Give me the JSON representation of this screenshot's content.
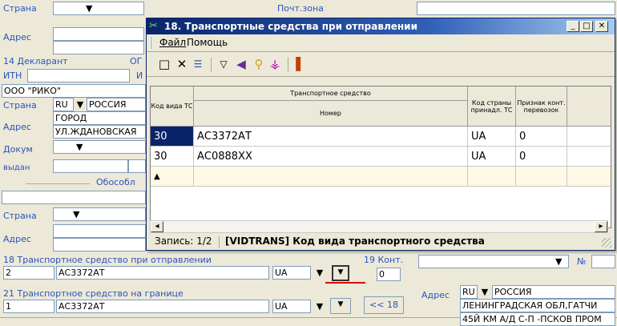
{
  "bg": {
    "strana_label": "Страна",
    "adres_label": "Адрес",
    "top_center_partial": "Почт.зона",
    "decl_label": "14 Декларант",
    "decl_og": "ОГ",
    "inn_label": "ИТН",
    "inn_tail": "И",
    "org_name": "ООО \"РИКО\"",
    "strana2_label": "Страна",
    "country_code": "RU",
    "country_name": "РОССИЯ",
    "adres2_label": "Адрес",
    "addr_line1": "ГОРОД",
    "addr_line2": "УЛ.ЖДАНОВСКАЯ",
    "dokum_label": "Докум",
    "vydan_label": "выдан",
    "obosob_label": "Обособл",
    "strana3_label": "Страна",
    "adres3_label": "Адрес",
    "f18_label": "18 Транспортное средство при отправлении",
    "f18_count": "2",
    "f18_number": "АС3372АТ",
    "f18_country": "UA",
    "f19_label": "19 Конт.",
    "f19_value": "0",
    "f21_label": "21 Транспортное средство на границе",
    "f21_count": "1",
    "f21_number": "АС3372АТ",
    "f21_country": "UA",
    "btn_back": "<< 18",
    "right_no": "№",
    "right_adres_label": "Адрес",
    "right_country_code": "RU",
    "right_country_name": "РОССИЯ",
    "right_addr1": "ЛЕНИНГРАДСКАЯ ОБЛ,ГАТЧИ",
    "right_addr2": "45Й КМ А/Д С-П -ПСКОВ ПРОМ"
  },
  "dialog": {
    "title": "18. Транспортные средства при отправлении",
    "menu": [
      "Файл",
      "Помощь"
    ],
    "toolbar_icons": [
      "new-icon",
      "delete-icon",
      "list-icon",
      "filter-icon",
      "flag-icon",
      "search-icon",
      "find-icon",
      "exit-icon"
    ],
    "columns": {
      "code_type": "Код вида ТС",
      "group": "Транспортное средство",
      "number": "Номер",
      "country_code": "Код страны принадл. ТС",
      "container_flag": "Признак конт. перевозок"
    },
    "rows": [
      {
        "code": "30",
        "number": "АС3372АТ",
        "country": "UA",
        "flag": "0"
      },
      {
        "code": "30",
        "number": "АС0888ХХ",
        "country": "UA",
        "flag": "0"
      }
    ],
    "status_record": "Запись: 1/2",
    "status_field": "[VIDTRANS] Код вида транспортного средства"
  },
  "colors": {
    "title_bar": "#0a246a",
    "label_blue": "#2a52be",
    "selection": "#0a246a",
    "underline_red": "#e00000"
  }
}
